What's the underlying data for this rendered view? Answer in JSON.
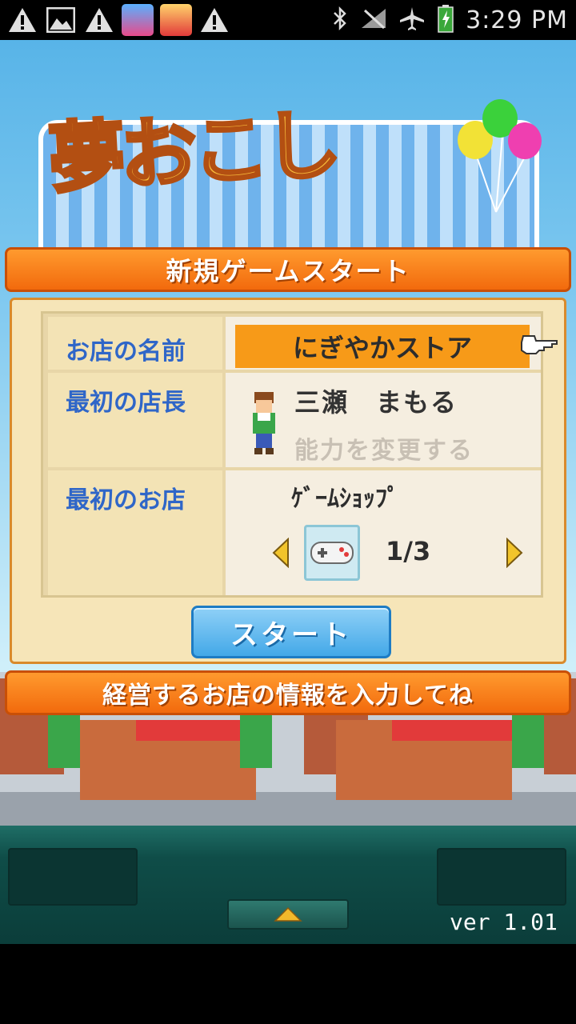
{
  "status_bar": {
    "time": "3:29 PM",
    "left_icons": [
      "warning-icon",
      "image-icon",
      "warning-icon",
      "bingo-app-icon",
      "shinchan-app-icon",
      "warning-icon"
    ],
    "right_icons": [
      "bluetooth-icon",
      "signal-off-icon",
      "airplane-icon",
      "battery-charging-icon"
    ]
  },
  "dialog": {
    "title": "新規ゲームスタート",
    "rows": {
      "shop_name_label": "お店の名前",
      "shop_name_value": "にぎやかストア",
      "manager_label": "最初の店長",
      "manager_name": "三瀬　まもる",
      "change_skill": "能力を変更する",
      "first_shop_label": "最初のお店",
      "first_shop_type": "ｹﾞｰﾑｼｮｯﾌﾟ",
      "shop_index": "1/3"
    },
    "start_button": "スタート",
    "hint": "経営するお店の情報を入力してね"
  },
  "footer": {
    "version": "ver 1.01"
  },
  "colors": {
    "accent_orange": "#f26a0d",
    "label_blue": "#2f66c8",
    "start_blue": "#43a8e8",
    "footer_teal": "#0f4d48"
  }
}
